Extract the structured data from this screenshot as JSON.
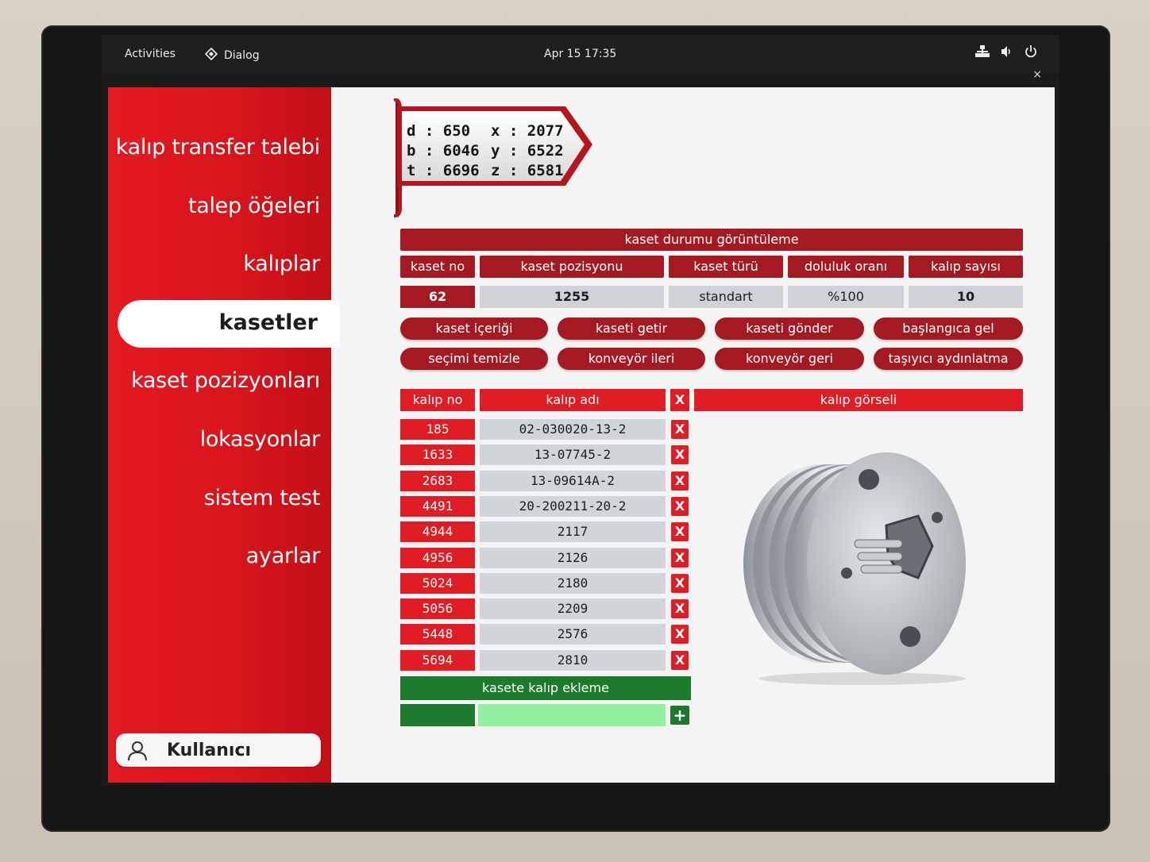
{
  "topbar": {
    "activities": "Activities",
    "app_name": "Dialog",
    "clock": "Apr 15  17:35",
    "close_symbol": "×"
  },
  "sidebar": {
    "items": [
      {
        "label": "kalıp transfer talebi"
      },
      {
        "label": "talep öğeleri"
      },
      {
        "label": "kalıplar"
      },
      {
        "label": "kasetler",
        "active": true
      },
      {
        "label": "kaset pozizyonları"
      },
      {
        "label": "lokasyonlar"
      },
      {
        "label": "sistem test"
      },
      {
        "label": "ayarlar"
      }
    ],
    "user_label": "Kullanıcı"
  },
  "coords": {
    "d_label": "d :",
    "d": "650",
    "b_label": "b :",
    "b": "6046",
    "t_label": "t :",
    "t": "6696",
    "x_label": "x :",
    "x": "2077",
    "y_label": "y :",
    "y": "6522",
    "z_label": "z :",
    "z": "6581"
  },
  "kaset": {
    "title": "kaset durumu görüntüleme",
    "headers": [
      "kaset no",
      "kaset pozisyonu",
      "kaset türü",
      "doluluk oranı",
      "kalıp sayısı"
    ],
    "values": [
      "62",
      "1255",
      "standart",
      "%100",
      "10"
    ],
    "buttons_row1": [
      "kaset içeriği",
      "kaseti getir",
      "kaseti gönder",
      "başlangıca gel"
    ],
    "buttons_row2": [
      "seçimi temizle",
      "konveyör ileri",
      "konveyör geri",
      "taşıyıcı aydınlatma"
    ]
  },
  "kalip": {
    "headers": {
      "no": "kalıp no",
      "name": "kalıp adı",
      "x": "X",
      "image": "kalıp görseli"
    },
    "rows": [
      {
        "no": "185",
        "name": "02-030020-13-2"
      },
      {
        "no": "1633",
        "name": "13-07745-2"
      },
      {
        "no": "2683",
        "name": "13-09614A-2"
      },
      {
        "no": "4491",
        "name": "20-200211-20-2"
      },
      {
        "no": "4944",
        "name": "2117"
      },
      {
        "no": "4956",
        "name": "2126"
      },
      {
        "no": "5024",
        "name": "2180"
      },
      {
        "no": "5056",
        "name": "2209"
      },
      {
        "no": "5448",
        "name": "2576"
      },
      {
        "no": "5694",
        "name": "2810"
      }
    ],
    "delete_symbol": "X",
    "add_title": "kasete kalıp ekleme",
    "add_symbol": "+"
  },
  "colors": {
    "sidebar_red": "#e41a22",
    "dark_red": "#a51a22",
    "bright_red": "#e01c24",
    "green": "#1c7a2c",
    "light_green": "#90f0a0",
    "gray_cell": "#d1d5d9"
  },
  "icons": [
    "network-icon",
    "volume-icon",
    "power-icon",
    "user-icon",
    "dialog-app-icon"
  ]
}
